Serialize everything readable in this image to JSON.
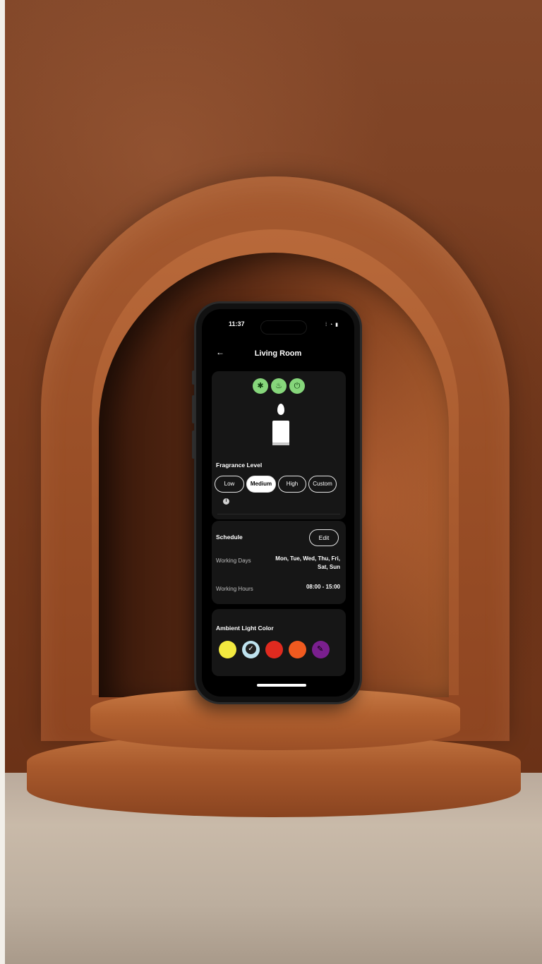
{
  "status_bar": {
    "time": "11:37",
    "icons": "⁞ ◔ ▮"
  },
  "nav": {
    "back_icon": "←",
    "title": "Living Room"
  },
  "device_icons": [
    "bluetooth-icon",
    "lamp-icon",
    "power-icon"
  ],
  "device_icon_glyphs": [
    "✱",
    "♨",
    "⏻"
  ],
  "fragrance": {
    "label": "Fragrance Level",
    "levels": [
      "Low",
      "Medium",
      "High",
      "Custom"
    ],
    "selected": "Medium",
    "info_glyph": "i"
  },
  "schedule": {
    "title": "Schedule",
    "edit_label": "Edit",
    "working_days_label": "Working Days",
    "working_days_value": "Mon, Tue, Wed, Thu, Fri, Sat, Sun",
    "working_hours_label": "Working Hours",
    "working_hours_value": "08:00 - 15:00"
  },
  "ambient": {
    "title": "Ambient Light Color",
    "colors": [
      "#f2e93f",
      "#bfe3ef",
      "#e02a1f",
      "#f05a1f",
      "#7a1f8e"
    ],
    "selected_index": 1,
    "custom_icon": "✎"
  },
  "colors": {
    "accent_green": "#86d67b",
    "screen_bg": "#000000",
    "card_bg": "#161616"
  }
}
